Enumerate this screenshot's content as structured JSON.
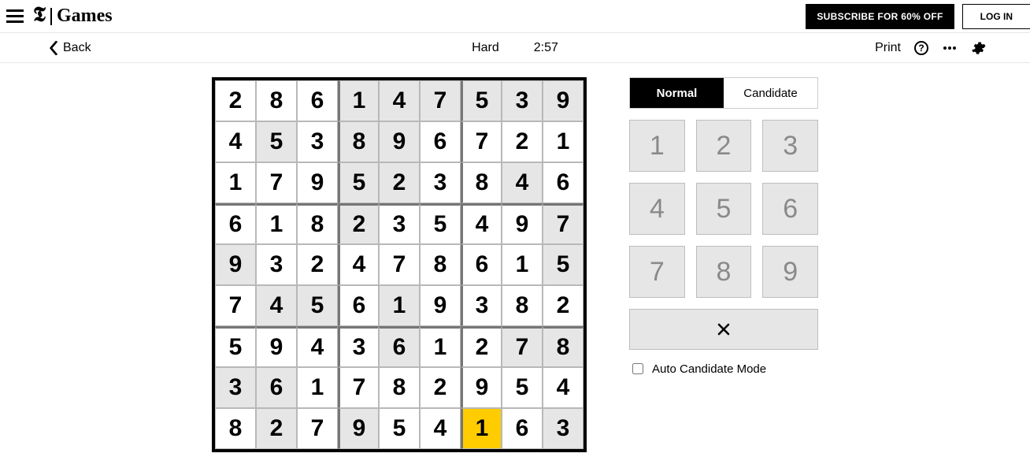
{
  "header": {
    "brand_t": "𝕿",
    "brand_word": "Games",
    "subscribe_label": "SUBSCRIBE FOR 60% OFF",
    "login_label": "LOG IN"
  },
  "toolbar": {
    "back_label": "Back",
    "difficulty": "Hard",
    "timer": "2:57",
    "print_label": "Print"
  },
  "modes": {
    "normal": "Normal",
    "candidate": "Candidate",
    "active": "normal"
  },
  "keypad": [
    "1",
    "2",
    "3",
    "4",
    "5",
    "6",
    "7",
    "8",
    "9"
  ],
  "auto_label": "Auto Candidate Mode",
  "board": {
    "values": [
      [
        "2",
        "8",
        "6",
        "1",
        "4",
        "7",
        "5",
        "3",
        "9"
      ],
      [
        "4",
        "5",
        "3",
        "8",
        "9",
        "6",
        "7",
        "2",
        "1"
      ],
      [
        "1",
        "7",
        "9",
        "5",
        "2",
        "3",
        "8",
        "4",
        "6"
      ],
      [
        "6",
        "1",
        "8",
        "2",
        "3",
        "5",
        "4",
        "9",
        "7"
      ],
      [
        "9",
        "3",
        "2",
        "4",
        "7",
        "8",
        "6",
        "1",
        "5"
      ],
      [
        "7",
        "4",
        "5",
        "6",
        "1",
        "9",
        "3",
        "8",
        "2"
      ],
      [
        "5",
        "9",
        "4",
        "3",
        "6",
        "1",
        "2",
        "7",
        "8"
      ],
      [
        "3",
        "6",
        "1",
        "7",
        "8",
        "2",
        "9",
        "5",
        "4"
      ],
      [
        "8",
        "2",
        "7",
        "9",
        "5",
        "4",
        "1",
        "6",
        "3"
      ]
    ],
    "prefilled": [
      [
        0,
        0,
        0,
        1,
        1,
        1,
        1,
        1,
        1
      ],
      [
        0,
        1,
        0,
        1,
        1,
        0,
        0,
        0,
        0
      ],
      [
        0,
        0,
        0,
        1,
        1,
        0,
        0,
        1,
        0
      ],
      [
        0,
        0,
        0,
        1,
        0,
        0,
        0,
        0,
        1
      ],
      [
        1,
        0,
        0,
        0,
        0,
        0,
        0,
        0,
        1
      ],
      [
        0,
        1,
        1,
        0,
        1,
        0,
        0,
        0,
        0
      ],
      [
        0,
        0,
        0,
        0,
        1,
        0,
        0,
        1,
        1
      ],
      [
        1,
        1,
        0,
        0,
        0,
        0,
        0,
        0,
        0
      ],
      [
        0,
        1,
        0,
        1,
        0,
        0,
        0,
        0,
        1
      ]
    ],
    "selected": [
      8,
      6
    ]
  }
}
